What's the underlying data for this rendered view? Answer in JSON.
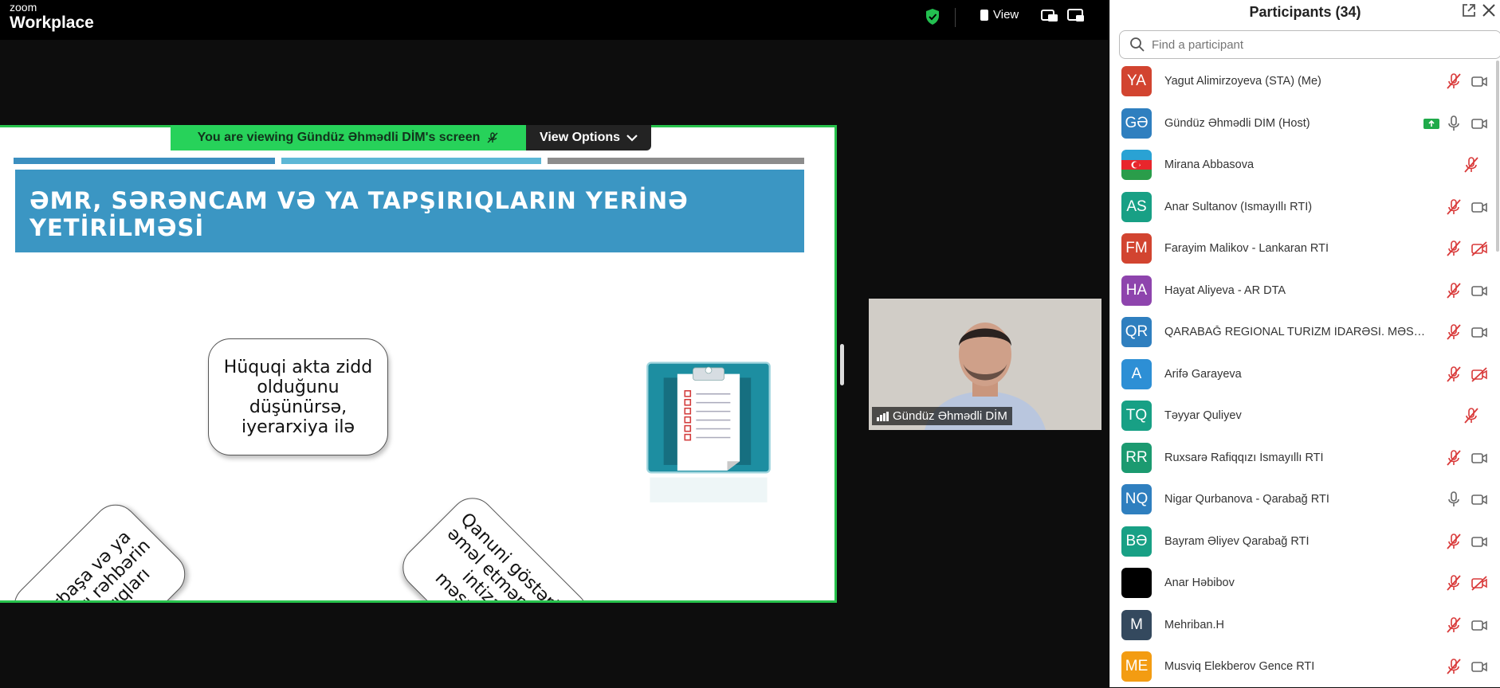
{
  "topbar": {
    "brand_small": "zoom",
    "brand_big": "Workplace",
    "view_label": "View"
  },
  "share": {
    "banner_text": "You are viewing  Gündüz Əhmədli DİM's screen",
    "view_options_label": "View Options",
    "slide": {
      "title_line1": "ƏMR, SƏRƏNCAM VƏ YA TAPŞIRIQLARIN YERİNƏ",
      "title_line2": "YETİRİLMƏSİ",
      "card_left": [
        "Birbaşa və ya",
        "yuxarı rəhbərin",
        "tapşırıqları"
      ],
      "card_middle": [
        "Hüquqi akta zidd",
        "olduğunu",
        "düşünürsə,",
        "iyerarxiya ilə"
      ],
      "card_right": [
        "Qanuni göstərişə",
        "əməl etməmək –",
        "intizam",
        "məsuliyyəti"
      ],
      "bar_colors": [
        "#3b8fc0",
        "#5cb7d6",
        "#8c8c8c"
      ]
    }
  },
  "video": {
    "name": "Gündüz Əhmədli DİM"
  },
  "participants": {
    "title": "Participants (34)",
    "search_placeholder": "Find a participant",
    "list": [
      {
        "initials": "YA",
        "name": "Yagut Alimirzoyeva (STA) (Me)",
        "color": "#d24430",
        "mic": "muted",
        "cam": "on",
        "share": false
      },
      {
        "initials": "GƏ",
        "name": "Gündüz Əhmədli DİM (Host)",
        "color": "#2f7fbf",
        "mic": "on",
        "cam": "on",
        "share": true
      },
      {
        "initials": "",
        "name": "Mirana Abbasova",
        "color": "flag",
        "mic": "muted",
        "cam": "none",
        "share": false
      },
      {
        "initials": "AS",
        "name": "Anar Sultanov (İsmayıllı RTİ)",
        "color": "#18a085",
        "mic": "muted",
        "cam": "on",
        "share": false
      },
      {
        "initials": "FM",
        "name": "Farayim Malikov - Lankaran RTİ",
        "color": "#d24430",
        "mic": "muted",
        "cam": "off",
        "share": false
      },
      {
        "initials": "HA",
        "name": "Hayat Aliyeva - AR DTA",
        "color": "#8e44ad",
        "mic": "muted",
        "cam": "on",
        "share": false
      },
      {
        "initials": "QR",
        "name": "QARABAĞ REGİONAL TURİZM İDARƏSİ. MƏSLƏ...",
        "color": "#2f7fbf",
        "mic": "muted",
        "cam": "on",
        "share": false
      },
      {
        "initials": "A",
        "name": "Arifə Garayeva",
        "color": "#2d8fd5",
        "mic": "muted",
        "cam": "off",
        "share": false
      },
      {
        "initials": "TQ",
        "name": "Təyyar Quliyev",
        "color": "#18a085",
        "mic": "muted",
        "cam": "none",
        "share": false
      },
      {
        "initials": "RR",
        "name": "Ruxsarə Rafiqqızı İsmayıllı RTİ",
        "color": "#1b9a70",
        "mic": "muted",
        "cam": "on",
        "share": false
      },
      {
        "initials": "NQ",
        "name": "Nigar Qurbanova - Qarabağ RTİ",
        "color": "#2f7fbf",
        "mic": "on",
        "cam": "on",
        "share": false
      },
      {
        "initials": "BƏ",
        "name": "Bayram Əliyev Qarabağ RTİ",
        "color": "#18a085",
        "mic": "muted",
        "cam": "on",
        "share": false
      },
      {
        "initials": "",
        "name": "Anar Həbibov",
        "color": "#000000",
        "mic": "muted",
        "cam": "off",
        "share": false
      },
      {
        "initials": "M",
        "name": "Mehriban.H",
        "color": "#34495e",
        "mic": "muted",
        "cam": "on",
        "share": false
      },
      {
        "initials": "ME",
        "name": "Musviq Elekberov Gence RTI",
        "color": "#f39c12",
        "mic": "muted",
        "cam": "on",
        "share": false
      }
    ]
  }
}
